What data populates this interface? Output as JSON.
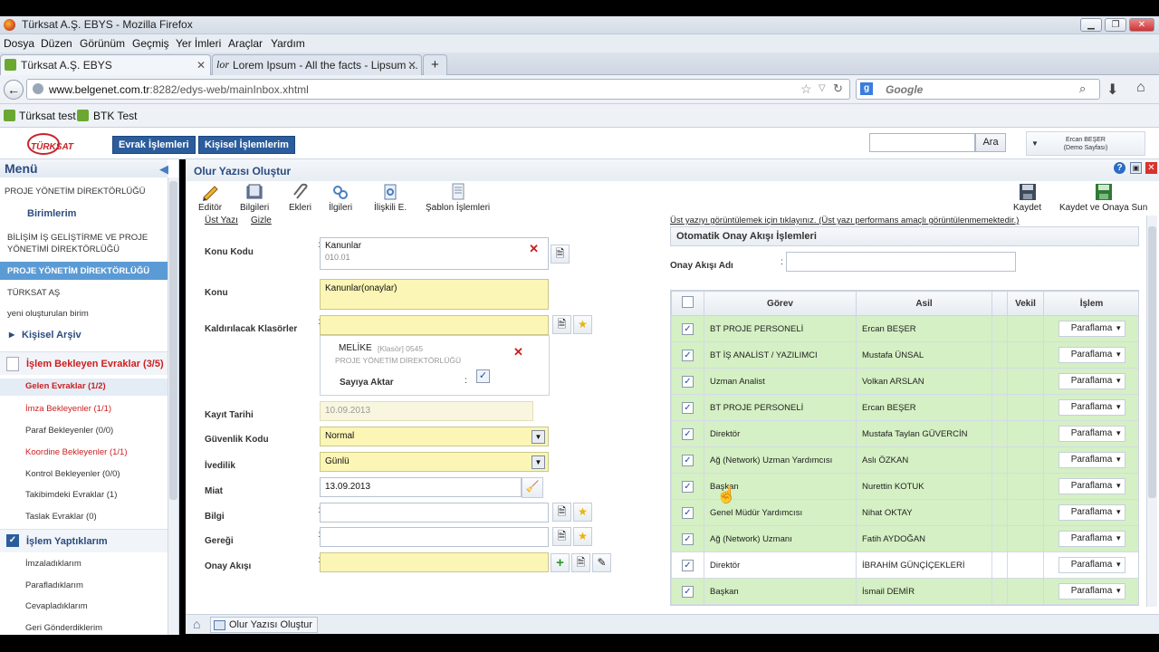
{
  "window": {
    "title": "Türksat A.Ş. EBYS - Mozilla Firefox"
  },
  "menubar": [
    "Dosya",
    "Düzen",
    "Görünüm",
    "Geçmiş",
    "Yer İmleri",
    "Araçlar",
    "Yardım"
  ],
  "tabs": [
    {
      "label": "Türksat A.Ş. EBYS",
      "active": true
    },
    {
      "label": "Lorem Ipsum - All the facts - Lipsum ...",
      "active": false
    }
  ],
  "address": {
    "host": "www.belgenet.com.tr",
    "path": ":8282/edys-web/mainInbox.xhtml"
  },
  "search": {
    "placeholder": "Google"
  },
  "bookmarks": [
    "Türksat test",
    "BTK Test"
  ],
  "app": {
    "logo_text": "TÜRKSAT",
    "top_buttons": [
      "Evrak İşlemleri",
      "Kişisel İşlemlerim"
    ],
    "search_button": "Ara",
    "user_name": "Ercan BEŞER",
    "user_sub": "(Demo Sayfası)"
  },
  "sidebar": {
    "title": "Menü",
    "dept": "PROJE YÖNETİM DİREKTÖRLÜĞÜ",
    "birimlerim": "Birimlerim",
    "units": [
      "BİLİŞİM İŞ GELİŞTİRME VE PROJE YÖNETİMİ DİREKTÖRLÜĞÜ",
      "PROJE YÖNETİM DİREKTÖRLÜĞÜ",
      "TÜRKSAT AŞ",
      "yeni oluşturulan birim"
    ],
    "archive": "Kişisel Arşiv",
    "pending": "İşlem Bekleyen Evraklar (3/5)",
    "pending_items": [
      "Gelen Evraklar (1/2)",
      "İmza Bekleyenler (1/1)",
      "Paraf Bekleyenler (0/0)",
      "Koordine Bekleyenler (1/1)",
      "Kontrol Bekleyenler (0/0)",
      "Takibimdeki Evraklar (1)",
      "Taslak Evraklar (0)"
    ],
    "done": "İşlem Yaptıklarım",
    "done_items": [
      "İmzaladıklarım",
      "Parafladıklarım",
      "Cevapladıklarım",
      "Geri Gönderdiklerim"
    ]
  },
  "page": {
    "title": "Olur Yazısı Oluştur",
    "toolbar": [
      "Editör",
      "Bilgileri",
      "Ekleri",
      "İlgileri",
      "İlişkili E.",
      "Şablon İşlemleri"
    ],
    "save": "Kaydet",
    "save_send": "Kaydet ve Onaya Sun",
    "ust_yazi": "Üst Yazı",
    "gizle": "Gizle",
    "preview_note": "Üst yazıyı görüntülemek için tıklayınız. (Üst yazı performans amaçlı görüntülenmemektedir.)"
  },
  "form": {
    "konu_kodu_label": "Konu Kodu",
    "konu_kodu_value": "Kanunlar",
    "konu_kodu_code": "010.01",
    "konu_label": "Konu",
    "konu_value": "Kanunlar(onaylar)",
    "klasor_label": "Kaldırılacak Klasörler",
    "klasor_item": "MELİKE",
    "klasor_meta": "[Klasör] 0545",
    "klasor_dept": "PROJE YÖNETİM DİREKTÖRLÜĞÜ",
    "sayiya_aktar": "Sayıya Aktar",
    "kayit_label": "Kayıt Tarihi",
    "kayit_value": "10.09.2013",
    "guvenlik_label": "Güvenlik Kodu",
    "guvenlik_value": "Normal",
    "ivedilik_label": "İvedilik",
    "ivedilik_value": "Günlü",
    "miat_label": "Miat",
    "miat_value": "13.09.2013",
    "bilgi_label": "Bilgi",
    "geregi_label": "Gereği",
    "onay_label": "Onay Akışı"
  },
  "approval": {
    "title": "Otomatik Onay Akışı İşlemleri",
    "name_label": "Onay Akışı Adı",
    "columns": [
      "Görev",
      "Asil",
      "Vekil",
      "İşlem"
    ],
    "rows": [
      {
        "gorev": "BT PROJE PERSONELİ",
        "asil": "Ercan BEŞER",
        "islem": "Paraflama",
        "g": true
      },
      {
        "gorev": "BT İŞ ANALİST / YAZILIMCI",
        "asil": "Mustafa ÜNSAL",
        "islem": "Paraflama",
        "g": true
      },
      {
        "gorev": "Uzman Analist",
        "asil": "Volkan ARSLAN",
        "islem": "Paraflama",
        "g": true
      },
      {
        "gorev": "BT PROJE PERSONELİ",
        "asil": "Ercan BEŞER",
        "islem": "Paraflama",
        "g": true
      },
      {
        "gorev": "Direktör",
        "asil": "Mustafa Taylan GÜVERCİN",
        "islem": "Paraflama",
        "g": true
      },
      {
        "gorev": "Ağ (Network) Uzman Yardımcısı",
        "asil": "Aslı ÖZKAN",
        "islem": "Paraflama",
        "g": true
      },
      {
        "gorev": "Başkan",
        "asil": "Nurettin KOTUK",
        "islem": "Paraflama",
        "g": true
      },
      {
        "gorev": "Genel Müdür Yardımcısı",
        "asil": "Nihat OKTAY",
        "islem": "Paraflama",
        "g": true
      },
      {
        "gorev": "Ağ (Network) Uzmanı",
        "asil": "Fatih AYDOĞAN",
        "islem": "Paraflama",
        "g": true
      },
      {
        "gorev": "Direktör",
        "asil": "İBRAHİM GÜNÇİÇEKLERİ",
        "islem": "Paraflama",
        "g": false
      },
      {
        "gorev": "Başkan",
        "asil": "İsmail DEMİR",
        "islem": "Paraflama",
        "g": true
      }
    ]
  },
  "bottom": {
    "tab": "Olur Yazısı Oluştur"
  },
  "colors": {
    "accent": "#2b5c9c",
    "row_green": "#d5f0c4",
    "field_yellow": "#fbf6b5",
    "active_menu": "#5b9bd5",
    "alert_red": "#cc1f1f"
  }
}
